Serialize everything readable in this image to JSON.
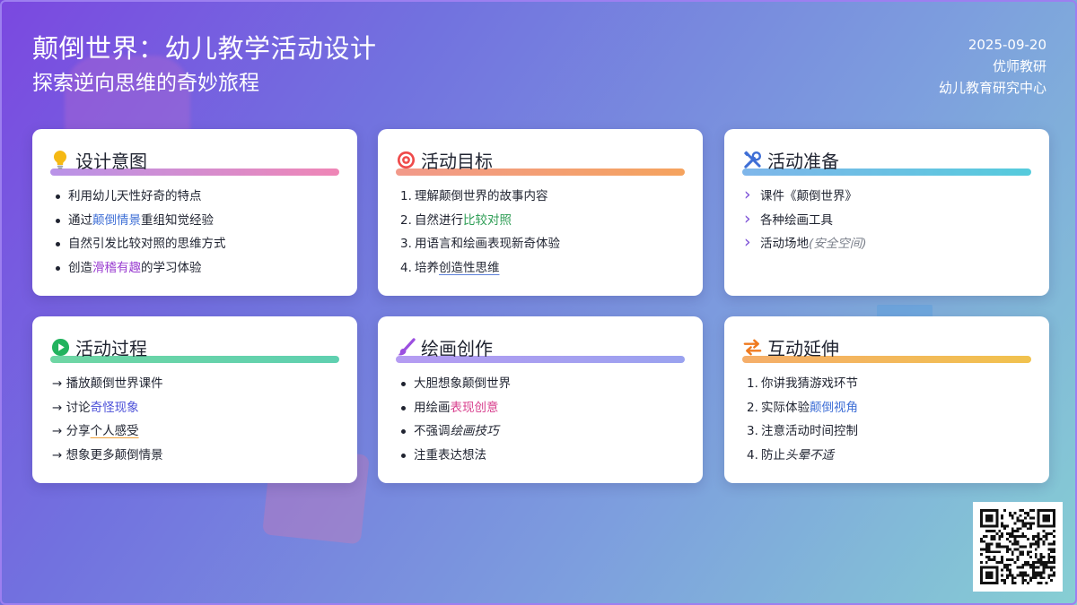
{
  "header": {
    "title": "颠倒世界：幼儿教学活动设计",
    "subtitle": "探索逆向思维的奇妙旅程"
  },
  "meta": {
    "date": "2025-09-20",
    "author": "优师教研",
    "org": "幼儿教育研究中心"
  },
  "cards": {
    "intent": {
      "title": "设计意图",
      "icon": "lightbulb-icon",
      "items": [
        {
          "a": "利用幼儿天性好奇的特点",
          "b": "",
          "c": ""
        },
        {
          "a": "通过",
          "b": "颠倒情景",
          "c": "重组知觉经验"
        },
        {
          "a": "自然引发比较对照的思维方式",
          "b": "",
          "c": ""
        },
        {
          "a": "创造",
          "b": "滑稽有趣",
          "c": "的学习体验"
        }
      ]
    },
    "goals": {
      "title": "活动目标",
      "icon": "target-icon",
      "items": [
        {
          "n": "1.",
          "a": "理解颠倒世界的故事内容",
          "b": "",
          "c": ""
        },
        {
          "n": "2.",
          "a": "自然进行",
          "b": "比较对照",
          "c": ""
        },
        {
          "n": "3.",
          "a": "用语言和绘画表现新奇体验",
          "b": "",
          "c": ""
        },
        {
          "n": "4.",
          "a": "培养",
          "b": "创造性思维",
          "c": ""
        }
      ]
    },
    "prep": {
      "title": "活动准备",
      "icon": "tools-icon",
      "items": [
        {
          "a": "课件《颠倒世界》",
          "b": ""
        },
        {
          "a": "各种绘画工具",
          "b": ""
        },
        {
          "a": "活动场地",
          "b": "(安全空间)"
        }
      ]
    },
    "process": {
      "title": "活动过程",
      "icon": "play-icon",
      "items": [
        {
          "arrow": "→",
          "a": "播放颠倒世界课件",
          "b": ""
        },
        {
          "arrow": "→",
          "a": "讨论",
          "b": "奇怪现象"
        },
        {
          "arrow": "→",
          "a": "分享",
          "b": "个人感受"
        },
        {
          "arrow": "→",
          "a": "想象更多颠倒情景",
          "b": ""
        }
      ]
    },
    "drawing": {
      "title": "绘画创作",
      "icon": "paintbrush-icon",
      "items": [
        {
          "a": "大胆想象颠倒世界",
          "b": ""
        },
        {
          "a": "用绘画",
          "b": "表现创意"
        },
        {
          "a": "不强调",
          "b": "绘画技巧"
        },
        {
          "a": "注重表达想法",
          "b": ""
        }
      ]
    },
    "extension": {
      "title": "互动延伸",
      "icon": "swap-arrows-icon",
      "items": [
        {
          "n": "1.",
          "a": "你讲我猜游戏环节",
          "b": ""
        },
        {
          "n": "2.",
          "a": "实际体验",
          "b": "颠倒视角"
        },
        {
          "n": "3.",
          "a": "注意活动时间控制",
          "b": ""
        },
        {
          "n": "4.",
          "a": "防止",
          "b": "头晕不适"
        }
      ]
    }
  },
  "qr": {
    "icon": "qr-code-icon"
  },
  "colors": {
    "intent_bar": "#c58ee0",
    "goals_bar": "#f2996e",
    "prep_bar": "#5cc4e0",
    "process_bar": "#5fd29a",
    "drawing_bar": "#a48ef0",
    "extension_bar": "#f2b04a"
  }
}
